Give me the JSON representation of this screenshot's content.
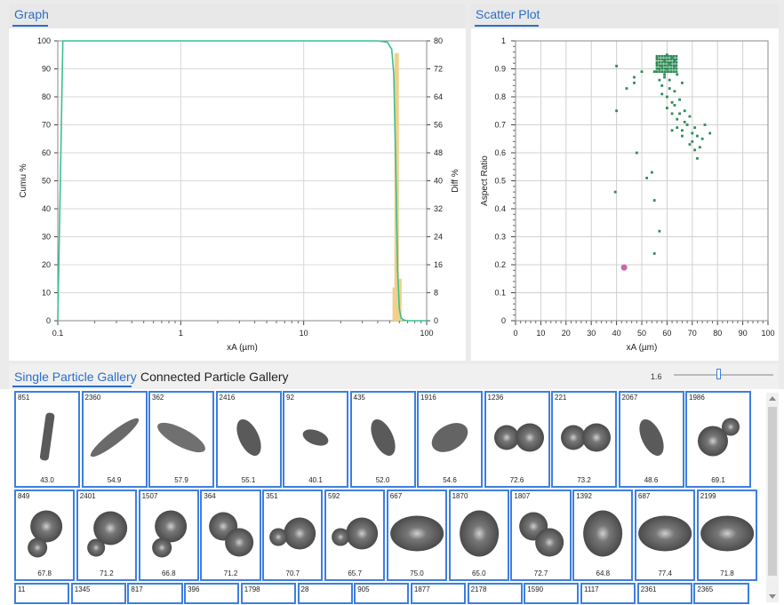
{
  "graph_panel": {
    "tab_label": "Graph"
  },
  "scatter_panel": {
    "tab_label": "Scatter Plot"
  },
  "chart_data": [
    {
      "type": "line",
      "x_scale": "log",
      "xlim": [
        0.1,
        100
      ],
      "xticks": [
        "0.1",
        "1",
        "10",
        "100"
      ],
      "xlabel": "xA (µm)",
      "ylabel": "Cumu %",
      "ylim": [
        0,
        100
      ],
      "yticks": [
        0,
        10,
        20,
        30,
        40,
        50,
        60,
        70,
        80,
        90,
        100
      ],
      "y2label": "Diff %",
      "y2lim": [
        0,
        80
      ],
      "y2ticks": [
        0,
        8,
        16,
        24,
        32,
        40,
        48,
        56,
        64,
        72,
        80
      ],
      "grid": true,
      "series": [
        {
          "color": "#3cc08f",
          "x": [
            0.1,
            0.105,
            0.11,
            1,
            10,
            40,
            48,
            52,
            54,
            56,
            58,
            60,
            62,
            65,
            70,
            100
          ],
          "y": [
            0,
            50,
            100,
            100,
            100,
            100,
            99.5,
            97,
            88,
            55,
            18,
            4,
            1,
            0.3,
            0,
            0
          ]
        },
        {
          "type": "bar",
          "color": "#f0d08a",
          "axis": "y2",
          "x": [
            55,
            57,
            60
          ],
          "y": [
            9.5,
            76.5,
            12
          ]
        }
      ]
    },
    {
      "type": "scatter",
      "xlim": [
        0,
        100
      ],
      "xticks": [
        0,
        10,
        20,
        30,
        40,
        50,
        60,
        70,
        80,
        90,
        100
      ],
      "xlabel": "xA (µm)",
      "ylim": [
        0,
        1
      ],
      "yticks": [
        "0",
        "0.1",
        "0.2",
        "0.3",
        "0.4",
        "0.5",
        "0.6",
        "0.7",
        "0.8",
        "0.9",
        "1"
      ],
      "ylabel": "Aspect Ratio",
      "grid": true,
      "series": [
        {
          "color": "#2e8b57",
          "points": [
            [
              40,
              0.91
            ],
            [
              40,
              0.75
            ],
            [
              39.5,
              0.46
            ],
            [
              47,
              0.87
            ],
            [
              47,
              0.85
            ],
            [
              44,
              0.83
            ],
            [
              50,
              0.89
            ],
            [
              48,
              0.6
            ],
            [
              52,
              0.51
            ],
            [
              54,
              0.53
            ],
            [
              55,
              0.43
            ],
            [
              57,
              0.32
            ],
            [
              55,
              0.24
            ],
            [
              62,
              0.68
            ],
            [
              66,
              0.66
            ],
            [
              70,
              0.64
            ],
            [
              73,
              0.62
            ],
            [
              72,
              0.58
            ],
            [
              75,
              0.7
            ],
            [
              77,
              0.67
            ],
            [
              74,
              0.65
            ],
            [
              68,
              0.7
            ],
            [
              64,
              0.72
            ],
            [
              67,
              0.75
            ],
            [
              62,
              0.78
            ],
            [
              60,
              0.8
            ],
            [
              58,
              0.84
            ],
            [
              63,
              0.82
            ],
            [
              65,
              0.79
            ],
            [
              69,
              0.73
            ],
            [
              71,
              0.69
            ],
            [
              59,
              0.87
            ],
            [
              61,
              0.86
            ],
            [
              57,
              0.9
            ],
            [
              56,
              0.92
            ],
            [
              59,
              0.93
            ],
            [
              62,
              0.94
            ],
            [
              63,
              0.91
            ],
            [
              60,
              0.9
            ],
            [
              58,
              0.91
            ],
            [
              64,
              0.88
            ],
            [
              66,
              0.85
            ],
            [
              61,
              0.83
            ],
            [
              63,
              0.77
            ],
            [
              65,
              0.74
            ],
            [
              67,
              0.71
            ],
            [
              70,
              0.67
            ],
            [
              72,
              0.66
            ],
            [
              69,
              0.63
            ],
            [
              71,
              0.61
            ],
            [
              60,
              0.76
            ],
            [
              62,
              0.74
            ],
            [
              64,
              0.69
            ],
            [
              66,
              0.68
            ],
            [
              58,
              0.81
            ],
            [
              57,
              0.86
            ],
            [
              55,
              0.89
            ],
            [
              56,
              0.94
            ],
            [
              60,
              0.95
            ],
            [
              61,
              0.92
            ],
            [
              63,
              0.93
            ],
            [
              59,
              0.88
            ]
          ]
        },
        {
          "color": "#cc66aa",
          "points": [
            [
              43,
              0.19
            ]
          ]
        }
      ]
    }
  ],
  "gallery": {
    "tab_single": "Single Particle Gallery",
    "tab_connected": "Connected Particle Gallery",
    "zoom_value": "1.6",
    "zoom_level": 0.45,
    "rows": [
      [
        {
          "id": "851",
          "value": "43.0",
          "shape": "stick"
        },
        {
          "id": "2360",
          "value": "54.9",
          "shape": "long"
        },
        {
          "id": "362",
          "value": "57.9",
          "shape": "long2"
        },
        {
          "id": "2416",
          "value": "55.1",
          "shape": "blob"
        },
        {
          "id": "92",
          "value": "40.1",
          "shape": "small"
        },
        {
          "id": "435",
          "value": "52.0",
          "shape": "blob"
        },
        {
          "id": "1916",
          "value": "54.6",
          "shape": "blob2"
        },
        {
          "id": "1236",
          "value": "72.6",
          "shape": "double"
        },
        {
          "id": "221",
          "value": "73.2",
          "shape": "double"
        },
        {
          "id": "2067",
          "value": "48.6",
          "shape": "blob"
        },
        {
          "id": "1986",
          "value": "69.1",
          "shape": "doubleup"
        }
      ],
      [
        {
          "id": "849",
          "value": "67.8",
          "shape": "doubledown"
        },
        {
          "id": "2401",
          "value": "71.2",
          "shape": "doubledown2"
        },
        {
          "id": "1507",
          "value": "66.8",
          "shape": "doubledown"
        },
        {
          "id": "364",
          "value": "71.2",
          "shape": "doublediag"
        },
        {
          "id": "351",
          "value": "70.7",
          "shape": "doubleleft"
        },
        {
          "id": "592",
          "value": "65.7",
          "shape": "doubleleft"
        },
        {
          "id": "667",
          "value": "75.0",
          "shape": "oval"
        },
        {
          "id": "1870",
          "value": "65.0",
          "shape": "round"
        },
        {
          "id": "1807",
          "value": "72.7",
          "shape": "doublediag"
        },
        {
          "id": "1392",
          "value": "64.8",
          "shape": "round"
        },
        {
          "id": "687",
          "value": "77.4",
          "shape": "oval"
        },
        {
          "id": "2199",
          "value": "71.8",
          "shape": "oval"
        }
      ],
      [
        {
          "id": "11"
        },
        {
          "id": "1345"
        },
        {
          "id": "817"
        },
        {
          "id": "396"
        },
        {
          "id": "1798"
        },
        {
          "id": "28"
        },
        {
          "id": "905"
        },
        {
          "id": "1877"
        },
        {
          "id": "2178"
        },
        {
          "id": "1590"
        },
        {
          "id": "1117"
        },
        {
          "id": "2361"
        },
        {
          "id": "2365"
        }
      ]
    ]
  }
}
